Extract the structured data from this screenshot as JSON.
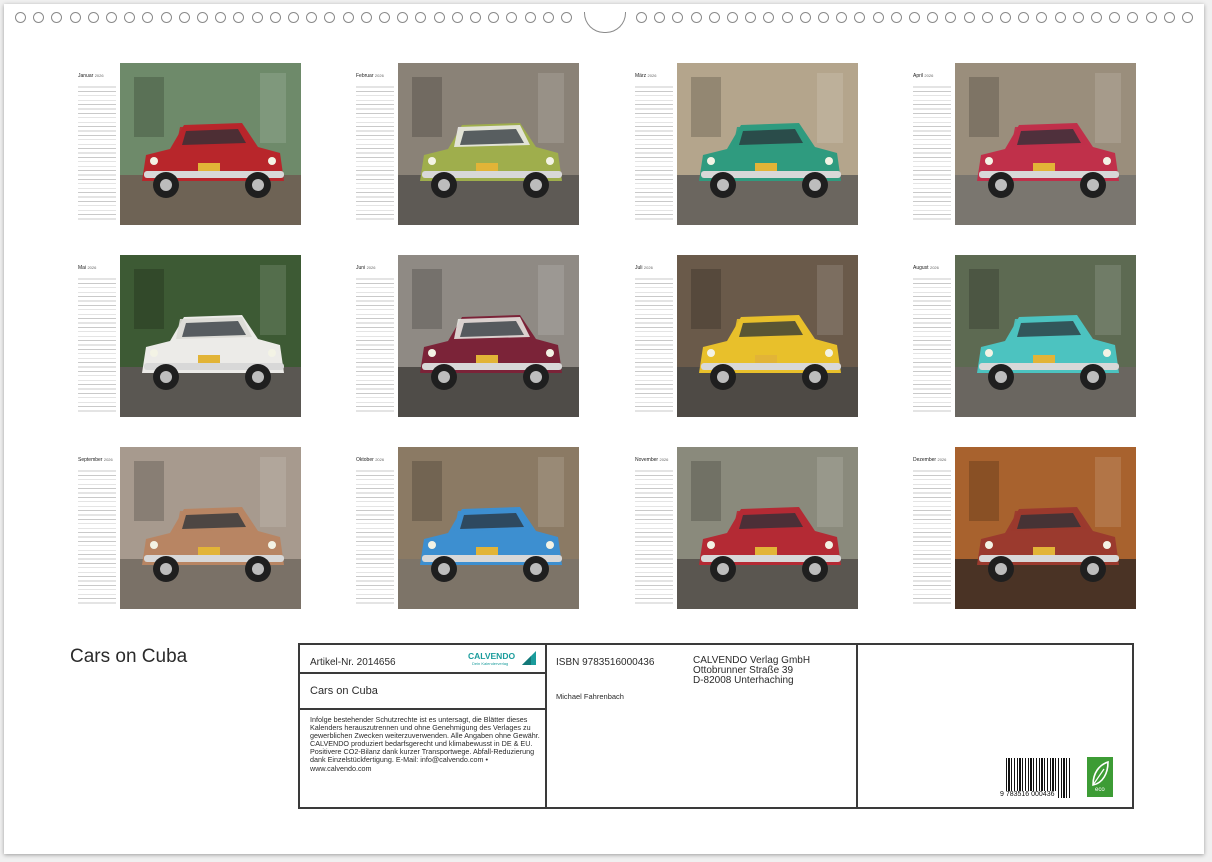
{
  "calendar": {
    "title": "Cars on Cuba",
    "year_label": "2026",
    "months": [
      {
        "name": "Januar",
        "photo": "red-classic-car"
      },
      {
        "name": "Februar",
        "photo": "green-classic-car"
      },
      {
        "name": "März",
        "photo": "turquoise-classic-car"
      },
      {
        "name": "April",
        "photo": "red-car-street"
      },
      {
        "name": "Mai",
        "photo": "white-car-rear"
      },
      {
        "name": "Juni",
        "photo": "maroon-classic-car"
      },
      {
        "name": "Juli",
        "photo": "yellow-convertible"
      },
      {
        "name": "August",
        "photo": "turquoise-convertible"
      },
      {
        "name": "September",
        "photo": "tan-classic-car"
      },
      {
        "name": "Oktober",
        "photo": "blue-car-arcades"
      },
      {
        "name": "November",
        "photo": "red-vintage-truck"
      },
      {
        "name": "Dezember",
        "photo": "red-car-night"
      }
    ]
  },
  "info": {
    "article": "Artikel-Nr. 2014656",
    "brand": "CALVENDO",
    "brand_tagline": "Dein Kalenderverlag",
    "title": "Cars on Cuba",
    "isbn": "ISBN 9783516000436",
    "author": "Michael Fahrenbach",
    "publisher_line1": "CALVENDO Verlag GmbH",
    "publisher_line2": "Ottobrunner Straße 39",
    "publisher_line3": "D-82008 Unterhaching",
    "legal": "Infolge bestehender Schutzrechte ist es untersagt, die Blätter dieses Kalenders herauszutrennen und ohne Genehmigung des Verlages zu gewerblichen Zwecken weiterzuverwenden. Alle Angaben ohne Gewähr. CALVENDO produziert bedarfsgerecht und klimabewusst in DE & EU. Positivere CO2-Bilanz dank kurzer Transportwege. Abfall-Reduzierung dank Einzelstückfertigung. E-Mail: info@calvendo.com • www.calvendo.com",
    "barcode_number": "9 783516 000436",
    "eco_label": "eco"
  },
  "colors": {
    "text": "#2b2b2b",
    "border": "#3a3a3a",
    "brand_teal": "#1a9c9c",
    "eco_green": "#3d9c35"
  }
}
